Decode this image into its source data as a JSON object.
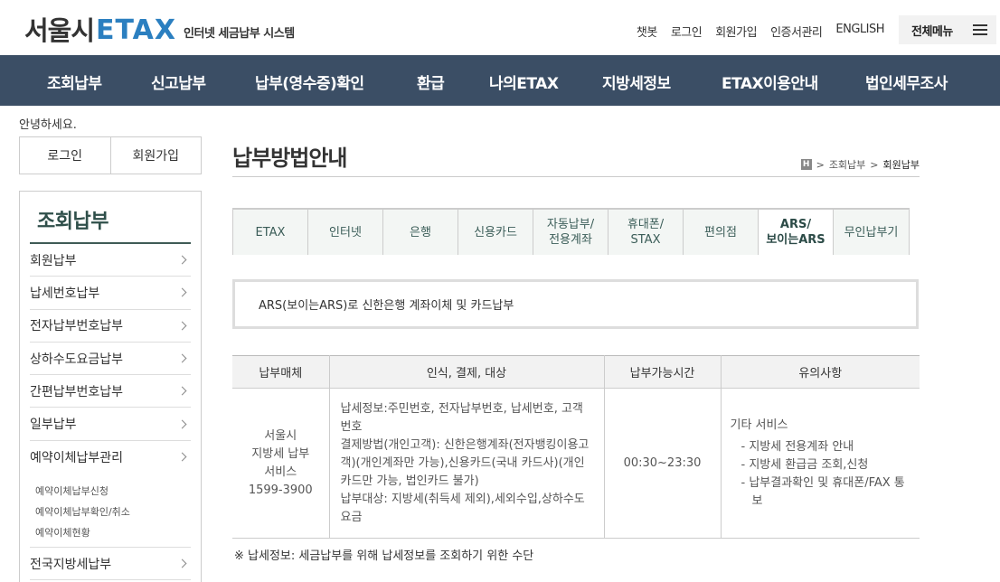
{
  "header": {
    "logo_seoul": "서울시",
    "logo_etax": "ETAX",
    "logo_sub": "인터넷 세금납부 시스템",
    "utils": [
      "챗봇",
      "로그인",
      "회원가입",
      "인증서관리",
      "ENGLISH"
    ],
    "all_menu": "전체메뉴"
  },
  "gnb": [
    "조회납부",
    "신고납부",
    "납부(영수증)확인",
    "환급",
    "나의ETAX",
    "지방세정보",
    "ETAX이용안내",
    "법인세무조사"
  ],
  "side": {
    "greeting": "안녕하세요.",
    "login": "로그인",
    "join": "회원가입",
    "title": "조회납부",
    "items": [
      "회원납부",
      "납세번호납부",
      "전자납부번호납부",
      "상하수도요금납부",
      "간편납부번호납부",
      "일부납부",
      "예약이체납부관리"
    ],
    "sub_items": [
      "예약이체납부신청",
      "예약이체납부확인/취소",
      "예약이체현황"
    ],
    "last_item": "전국지방세납부"
  },
  "content": {
    "title": "납부방법안내",
    "home": "H",
    "crumb1": "조회납부",
    "crumb2": "회원납부",
    "tabs": [
      {
        "l1": "ETAX",
        "l2": ""
      },
      {
        "l1": "인터넷",
        "l2": ""
      },
      {
        "l1": "은행",
        "l2": ""
      },
      {
        "l1": "신용카드",
        "l2": ""
      },
      {
        "l1": "자동납부/",
        "l2": "전용계좌"
      },
      {
        "l1": "휴대폰/",
        "l2": "STAX"
      },
      {
        "l1": "편의점",
        "l2": ""
      },
      {
        "l1": "ARS/",
        "l2": "보이는ARS"
      },
      {
        "l1": "무인납부기",
        "l2": ""
      }
    ],
    "info": "ARS(보이는ARS)로 신한은행 계좌이체 및 카드납부",
    "table": {
      "headers": [
        "납부매체",
        "인식, 결제, 대상",
        "납부가능시간",
        "유의사항"
      ],
      "media": [
        "서울시",
        "지방세 납부",
        "서비스",
        "1599-3900"
      ],
      "desc": [
        "납세정보:주민번호, 전자납부번호, 납세번호, 고객번호",
        "결제방법(개인고객): 신한은행계좌(전자뱅킹이용고객)(개인계좌만 가능),신용카드(국내 카드사)(개인카드만 가능, 법인카드 불가)",
        "납부대상: 지방세(취득세 제외),세외수입,상하수도요금"
      ],
      "time": "00:30~23:30",
      "notes_title": "기타 서비스",
      "notes": [
        "지방세 전용계좌 안내",
        "지방세 환급금 조회,신청",
        "납부결과확인 및 휴대폰/FAX 통보"
      ]
    },
    "footnote": "※ 납세정보: 세금납부를 위해 납세정보를 조회하기 위한 수단"
  }
}
